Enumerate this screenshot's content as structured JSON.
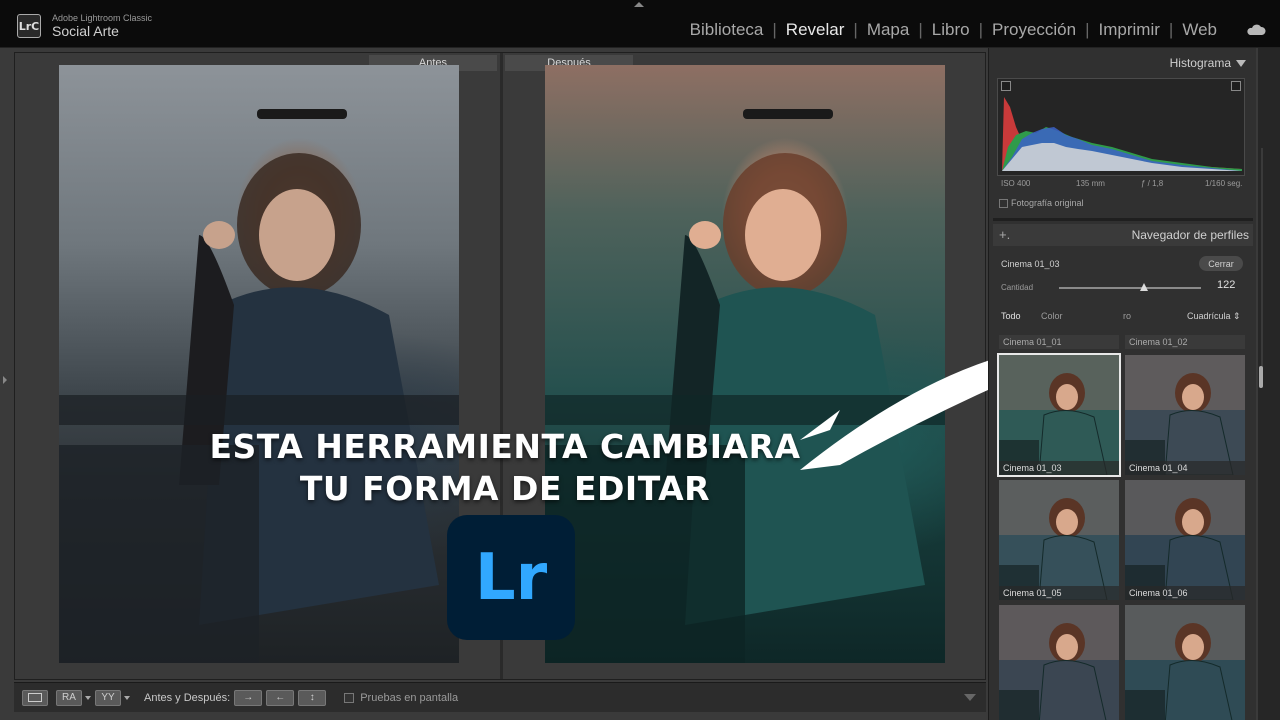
{
  "app": {
    "logo": "LrC",
    "name": "Adobe Lightroom Classic",
    "catalog": "Social Arte"
  },
  "modules": [
    {
      "label": "Biblioteca",
      "active": false
    },
    {
      "label": "Revelar",
      "active": true
    },
    {
      "label": "Mapa",
      "active": false
    },
    {
      "label": "Libro",
      "active": false
    },
    {
      "label": "Proyección",
      "active": false
    },
    {
      "label": "Imprimir",
      "active": false
    },
    {
      "label": "Web",
      "active": false
    }
  ],
  "view": {
    "before_label": "Antes",
    "after_label": "Después"
  },
  "overlay": {
    "headline_line1": "ESTA HERRAMIENTA CAMBIARA",
    "headline_line2": "TU FORMA DE EDITAR",
    "logo_text": "Lr",
    "logo_bg": "#001e36",
    "logo_fg": "#31a8ff"
  },
  "toolbar": {
    "view_icon_1": "RA",
    "view_icon_2": "YY",
    "before_after_label": "Antes y Después:",
    "proof_label": "Pruebas en pantalla"
  },
  "histogram": {
    "title": "Histograma",
    "iso": "ISO 400",
    "focal": "135 mm",
    "aperture": "ƒ / 1,8",
    "shutter": "1/160 seg.",
    "original_photo_label": "Fotografía original"
  },
  "profile_browser": {
    "plus": "+.",
    "title": "Navegador de perfiles",
    "current_profile": "Cinema 01_03",
    "close_label": "Cerrar",
    "amount_label": "Cantidad",
    "amount_value": "122",
    "amount_fraction": 0.6,
    "filter_all": "Todo",
    "filter_color": "Color",
    "filter_bw": "ro",
    "grid_label": "Cuadrícula",
    "top_row": [
      "Cinema 01_01",
      "Cinema 01_02"
    ],
    "thumbs": [
      {
        "label": "Cinema 01_03",
        "selected": true,
        "tint": "#2f5a56"
      },
      {
        "label": "Cinema 01_04",
        "selected": false,
        "tint": "#3d4a55"
      },
      {
        "label": "Cinema 01_05",
        "selected": false,
        "tint": "#36505a"
      },
      {
        "label": "Cinema 01_06",
        "selected": false,
        "tint": "#324553"
      },
      {
        "label": "",
        "selected": false,
        "tint": "#3b4652"
      },
      {
        "label": "",
        "selected": false,
        "tint": "#2f4b55"
      }
    ]
  }
}
